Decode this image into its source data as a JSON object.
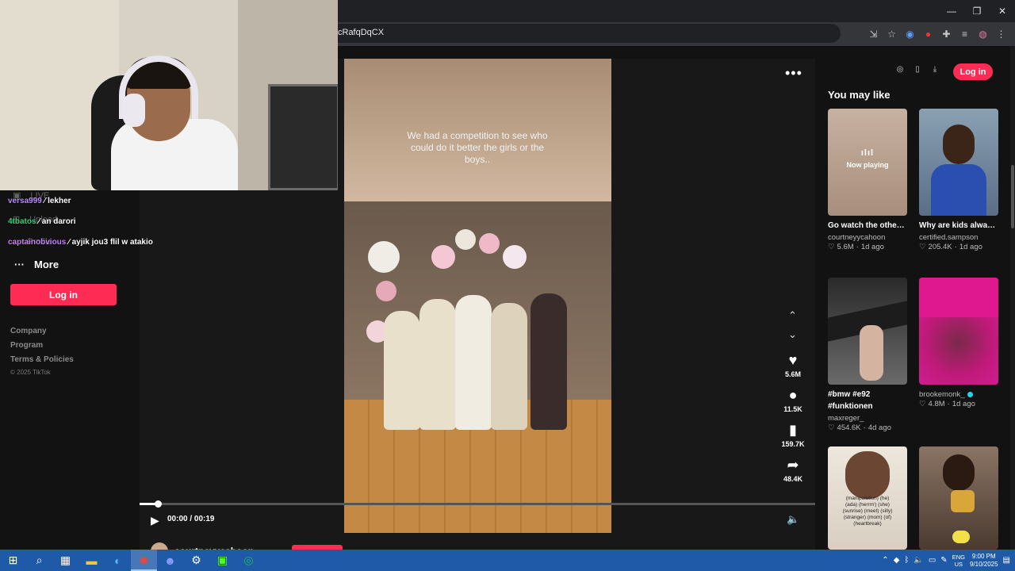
{
  "browser": {
    "url_fragment": "cRafqDqCX",
    "window_controls": {
      "minimize": "—",
      "restore": "❐",
      "close": "✕"
    }
  },
  "sidebar": {
    "ghost_items": [
      {
        "icon": "live-icon",
        "label": "LIVE"
      },
      {
        "icon": "upload-icon",
        "label": "Upload"
      },
      {
        "icon": "profile-icon",
        "label": "Profile"
      }
    ],
    "chat": [
      {
        "user": "versa999",
        "message": "lekher",
        "color": "#b98cff"
      },
      {
        "user": "4tbatos",
        "message": "an darori",
        "color": "#33d17a"
      },
      {
        "user": "captainobvious",
        "message": "ayjik jou3 flil w atakio",
        "color": "#c77dff"
      }
    ],
    "more_label": "More",
    "login_label": "Log in",
    "footer_links": [
      "Company",
      "Program",
      "Terms & Policies"
    ],
    "copyright": "© 2025 TikTok"
  },
  "video": {
    "caption": "We had a competition to see who could do it better the girls or the boys..",
    "time": "00:00 / 00:19",
    "progress": 0.027,
    "author": "courtneyycahoon",
    "actions": [
      {
        "name": "like",
        "icon": "♥",
        "count": "5.6M"
      },
      {
        "name": "comment",
        "icon": "●",
        "count": "11.5K"
      },
      {
        "name": "bookmark",
        "icon": "▮",
        "count": "159.7K"
      },
      {
        "name": "share",
        "icon": "➦",
        "count": "48.4K"
      }
    ]
  },
  "right": {
    "login_label": "Log in",
    "heading": "You may like",
    "now_playing": "Now playing",
    "cards": [
      {
        "title": "Go watch the other video and vote in t...",
        "author": "courtneyycahoon",
        "likes": "5.6M",
        "age": "1d ago",
        "bg": "#b89e8c",
        "now_playing": true
      },
      {
        "title": "Why are kids always so messy after thei...",
        "author": "certified.sampson",
        "likes": "205.4K",
        "age": "1d ago",
        "bg": "#7a8ea0"
      },
      {
        "title": "#bmw #e92 #funktionen",
        "author": "maxreger_",
        "likes": "454.6K",
        "age": "4d ago",
        "bg": "#3a3a3a"
      },
      {
        "title": "",
        "author": "brookemonk_",
        "likes": "4.8M",
        "age": "1d ago",
        "bg": "#d0207a",
        "verified": true
      },
      {
        "title": "",
        "author": "",
        "likes": "",
        "age": "",
        "bg": "#e8e2d8",
        "thumb_text": "(manipulation) (he) (ada) (herrrrr) (she) (sunrise) (meet) (silly) (stranger) (mom) (of) (heartbreak)"
      },
      {
        "title": "",
        "author": "",
        "likes": "",
        "age": "",
        "bg": "#6a5546"
      }
    ]
  },
  "taskbar": {
    "apps": [
      "start-icon",
      "search-icon",
      "task-view-icon",
      "file-explorer-icon",
      "edge-icon",
      "chrome-icon",
      "discord-icon",
      "steam-icon",
      "app-icon",
      "spotify-icon"
    ],
    "lang": "ENG",
    "region": "US",
    "time": "9:00 PM",
    "date": "9/10/2025"
  }
}
